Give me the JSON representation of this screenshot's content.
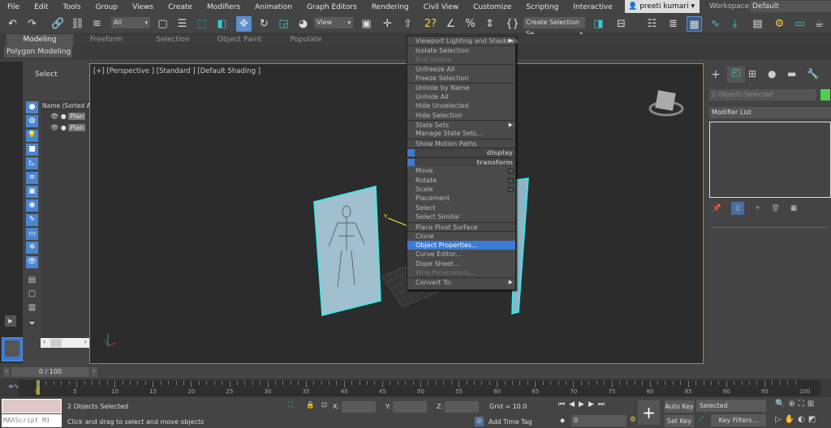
{
  "menubar": {
    "items": [
      "File",
      "Edit",
      "Tools",
      "Group",
      "Views",
      "Create",
      "Modifiers",
      "Animation",
      "Graph Editors",
      "Rendering",
      "Civil View",
      "Customize",
      "Scripting",
      "Interactive"
    ],
    "user": "preeti kumari",
    "workspaces_label": "Workspaces:",
    "workspace": "Default"
  },
  "toolbar": {
    "selection_filter": "All",
    "ref_coord": "View",
    "named_selection": "Create Selection Se"
  },
  "ribbon": {
    "tabs": [
      "Modeling",
      "Freeform",
      "Selection",
      "Object Paint",
      "Populate"
    ],
    "active": "Modeling",
    "panel": "Polygon Modeling"
  },
  "explorer": {
    "title": "Select",
    "column": "Name (Sorted A",
    "rows": [
      "Plan",
      "Plan"
    ]
  },
  "viewport": {
    "label": "[+] [Perspective ] [Standard ] [Default Shading ]",
    "accent": "#a88a2e"
  },
  "context_menu": {
    "items": [
      {
        "label": "Viewport Lighting and Shadows",
        "submenu": true
      },
      {
        "label": "Isolate Selection",
        "sep": true
      },
      {
        "label": "End Isolate",
        "disabled": true
      },
      {
        "label": "Unfreeze All",
        "sep": true
      },
      {
        "label": "Freeze Selection"
      },
      {
        "label": "Unhide by Name",
        "sep": true
      },
      {
        "label": "Unhide All"
      },
      {
        "label": "Hide Unselected"
      },
      {
        "label": "Hide Selection"
      },
      {
        "label": "State Sets",
        "sep": true,
        "submenu": true
      },
      {
        "label": "Manage State Sets..."
      },
      {
        "label": "Show Motion Paths",
        "sep": true
      },
      {
        "label": "display",
        "header": true
      },
      {
        "label": "transform",
        "header": true
      },
      {
        "label": "Move",
        "box": true
      },
      {
        "label": "Rotate",
        "box": true
      },
      {
        "label": "Scale",
        "box": true
      },
      {
        "label": "Placement"
      },
      {
        "label": "Select"
      },
      {
        "label": "Select Similar"
      },
      {
        "label": "Place Pivot Surface",
        "sep": true
      },
      {
        "label": "Clone",
        "sep": true
      },
      {
        "label": "Object Properties...",
        "highlighted": true
      },
      {
        "label": "Curve Editor..."
      },
      {
        "label": "Dope Sheet..."
      },
      {
        "label": "Wire Parameters...",
        "disabled": true
      },
      {
        "label": "Convert To:",
        "sep": true,
        "submenu": true
      }
    ]
  },
  "command_panel": {
    "selection_name": "2 Objects Selected",
    "object_color": "#4cd04c",
    "modifier_list": "Modifier List"
  },
  "time_slider": {
    "value": "0 / 100",
    "current_frame": 0,
    "total": 100
  },
  "trackbar": {
    "ticks": [
      "0",
      "5",
      "10",
      "15",
      "20",
      "25",
      "30",
      "35",
      "40",
      "45",
      "50",
      "55",
      "60",
      "65",
      "70",
      "75",
      "80",
      "85",
      "90",
      "95",
      "100"
    ]
  },
  "status": {
    "maxscript": "MAXScript Mi",
    "selected": "2 Objects Selected",
    "prompt": "Click and drag to select and move objects",
    "x_label": "X:",
    "y_label": "Y:",
    "z_label": "Z:",
    "grid": "Grid = 10.0",
    "add_time_tag": "Add Time Tag",
    "auto_key": "Auto Key",
    "set_key": "Set Key",
    "key_mode": "Selected",
    "key_filters": "Key Filters...",
    "frame": "0"
  }
}
